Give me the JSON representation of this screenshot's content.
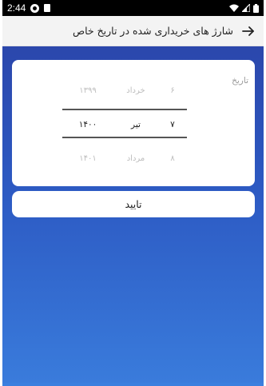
{
  "status_bar": {
    "time": "2:44"
  },
  "app_bar": {
    "title": "شارژ های خریداری شده در تاریخ خاص",
    "back_icon": "arrow-right-icon"
  },
  "date_picker": {
    "label": "تاریخ",
    "rows": [
      {
        "day": "۶",
        "month": "خرداد",
        "year": "۱۳۹۹",
        "selected": false
      },
      {
        "day": "۷",
        "month": "تیر",
        "year": "۱۴۰۰",
        "selected": true
      },
      {
        "day": "۸",
        "month": "مرداد",
        "year": "۱۴۰۱",
        "selected": false
      }
    ]
  },
  "confirm_button": {
    "label": "تایید"
  },
  "colors": {
    "gradient_top": "#2b47ac",
    "gradient_bottom": "#3a7cdc",
    "app_bar": "#f3f3f3"
  }
}
